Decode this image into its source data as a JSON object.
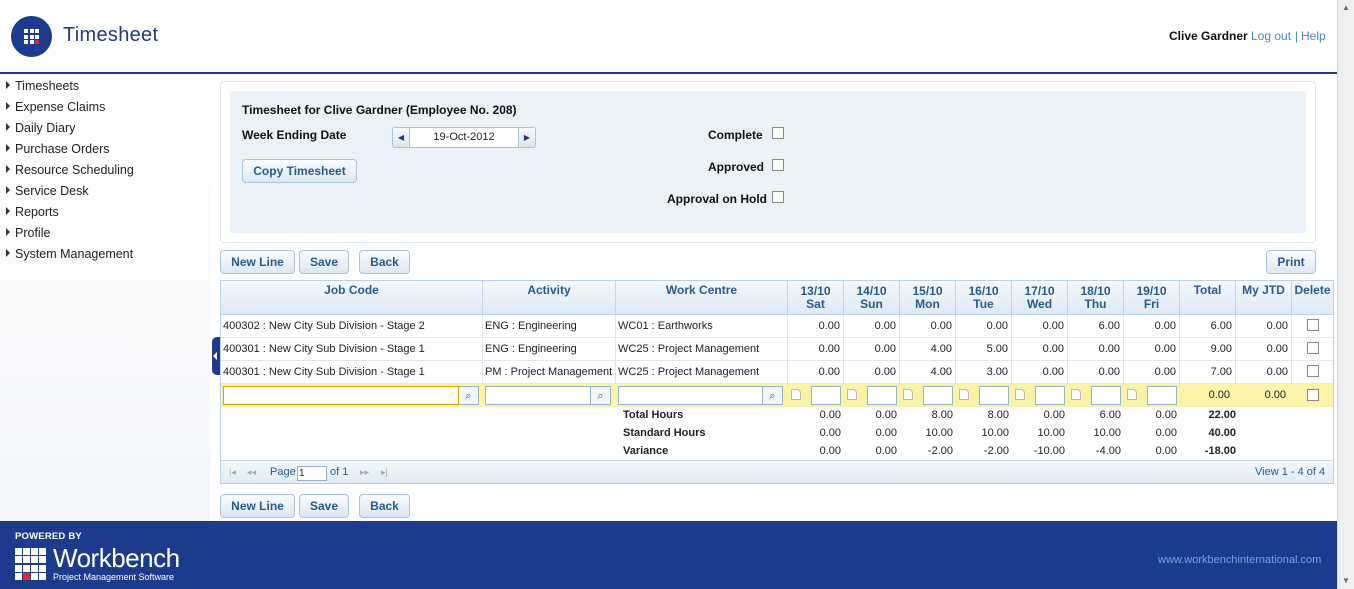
{
  "header": {
    "title": "Timesheet",
    "user_name": "Clive Gardner",
    "logout": "Log out",
    "separator": "|",
    "help": "Help"
  },
  "sidebar": {
    "items": [
      {
        "label": "Timesheets"
      },
      {
        "label": "Expense Claims"
      },
      {
        "label": "Daily Diary"
      },
      {
        "label": "Purchase Orders"
      },
      {
        "label": "Resource Scheduling"
      },
      {
        "label": "Service Desk"
      },
      {
        "label": "Reports"
      },
      {
        "label": "Profile"
      },
      {
        "label": "System Management"
      }
    ]
  },
  "form": {
    "heading": "Timesheet for Clive Gardner (Employee No. 208)",
    "week_ending_label": "Week Ending Date",
    "week_ending_value": "19-Oct-2012",
    "copy_button": "Copy Timesheet",
    "complete_label": "Complete",
    "approved_label": "Approved",
    "approval_hold_label": "Approval on Hold",
    "complete": false,
    "approved": false,
    "approval_on_hold": false
  },
  "toolbar": {
    "new_line": "New Line",
    "save": "Save",
    "back": "Back",
    "print": "Print"
  },
  "grid": {
    "headers": {
      "job_code": "Job Code",
      "activity": "Activity",
      "work_centre": "Work Centre",
      "days": [
        {
          "date": "13/10",
          "day": "Sat"
        },
        {
          "date": "14/10",
          "day": "Sun"
        },
        {
          "date": "15/10",
          "day": "Mon"
        },
        {
          "date": "16/10",
          "day": "Tue"
        },
        {
          "date": "17/10",
          "day": "Wed"
        },
        {
          "date": "18/10",
          "day": "Thu"
        },
        {
          "date": "19/10",
          "day": "Fri"
        }
      ],
      "total": "Total",
      "my_jtd": "My JTD",
      "delete": "Delete"
    },
    "rows": [
      {
        "job": "400302 : New City Sub Division - Stage 2",
        "activity": "ENG : Engineering",
        "centre": "WC01 : Earthworks",
        "hours": [
          "0.00",
          "0.00",
          "0.00",
          "0.00",
          "0.00",
          "6.00",
          "0.00"
        ],
        "total": "6.00",
        "jtd": "0.00"
      },
      {
        "job": "400301 : New City Sub Division - Stage 1",
        "activity": "ENG : Engineering",
        "centre": "WC25 : Project Management",
        "hours": [
          "0.00",
          "0.00",
          "4.00",
          "5.00",
          "0.00",
          "0.00",
          "0.00"
        ],
        "total": "9.00",
        "jtd": "0.00"
      },
      {
        "job": "400301 : New City Sub Division - Stage 1",
        "activity": "PM : Project Management",
        "centre": "WC25 : Project Management",
        "hours": [
          "0.00",
          "0.00",
          "4.00",
          "3.00",
          "0.00",
          "0.00",
          "0.00"
        ],
        "total": "7.00",
        "jtd": "0.00"
      }
    ],
    "edit_row": {
      "total": "0.00",
      "jtd": "0.00"
    },
    "summary": [
      {
        "label": "Total Hours",
        "hours": [
          "0.00",
          "0.00",
          "8.00",
          "8.00",
          "0.00",
          "6.00",
          "0.00"
        ],
        "total": "22.00"
      },
      {
        "label": "Standard Hours",
        "hours": [
          "0.00",
          "0.00",
          "10.00",
          "10.00",
          "10.00",
          "10.00",
          "0.00"
        ],
        "total": "40.00"
      },
      {
        "label": "Variance",
        "hours": [
          "0.00",
          "0.00",
          "-2.00",
          "-2.00",
          "-10.00",
          "-4.00",
          "0.00"
        ],
        "total": "-18.00"
      }
    ]
  },
  "pager": {
    "page_label": "Page",
    "page_value": "1",
    "of_label": "of 1",
    "view_text": "View 1 - 4 of 4"
  },
  "footer": {
    "powered_by": "POWERED BY",
    "brand": "Workbench",
    "tagline": "Project Management Software",
    "url": "www.workbenchinternational.com"
  },
  "colors": {
    "brand_navy": "#1c3b8c",
    "link_blue": "#4a86c5",
    "edit_row_yellow": "#fbf3a8"
  }
}
